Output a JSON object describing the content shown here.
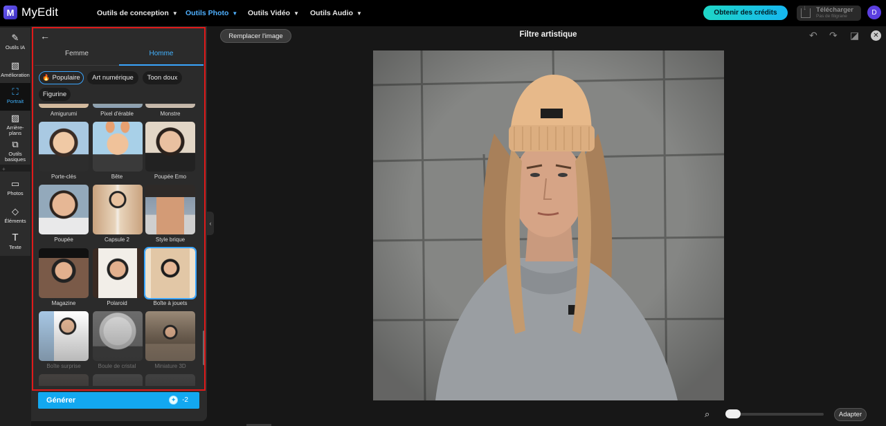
{
  "app": {
    "name": "MyEdit",
    "logo_letter": "M"
  },
  "nav": [
    {
      "label": "Outils de conception",
      "active": false
    },
    {
      "label": "Outils Photo",
      "active": true
    },
    {
      "label": "Outils Vidéo",
      "active": false
    },
    {
      "label": "Outils Audio",
      "active": false
    }
  ],
  "header": {
    "credits_button": "Obtenir des crédits",
    "download_title": "Télécharger",
    "download_sub": "Pas de filigrane",
    "avatar_initial": "D"
  },
  "rail": [
    {
      "label": "Outils IA",
      "icon": "magic-wand-icon",
      "glyph": "✎",
      "active": false
    },
    {
      "label": "Amélioration",
      "icon": "enhance-icon",
      "glyph": "▧",
      "active": false
    },
    {
      "label": "Portrait",
      "icon": "portrait-icon",
      "glyph": "⛶",
      "active": true
    },
    {
      "label": "Arrière-plans",
      "icon": "background-icon",
      "glyph": "▨",
      "active": false
    },
    {
      "label": "Outils basiques",
      "icon": "crop-icon",
      "glyph": "⧉",
      "active": false
    },
    {
      "label": "Photos",
      "icon": "photos-icon",
      "glyph": "▭",
      "active": false
    },
    {
      "label": "Éléments",
      "icon": "elements-icon",
      "glyph": "◇",
      "active": false
    },
    {
      "label": "Texte",
      "icon": "text-icon",
      "glyph": "T",
      "active": false
    }
  ],
  "panel": {
    "tabs": [
      {
        "label": "Femme",
        "active": false
      },
      {
        "label": "Homme",
        "active": true
      }
    ],
    "chips": [
      {
        "label": "Populaire",
        "active": true
      },
      {
        "label": "Art numérique",
        "active": false
      },
      {
        "label": "Toon doux",
        "active": false
      },
      {
        "label": "Figurine",
        "active": false
      }
    ],
    "top_row_labels": [
      "Amigurumi",
      "Pixel d'érable",
      "Monstre"
    ],
    "styles": [
      {
        "label": "Porte-clés",
        "selected": false
      },
      {
        "label": "Bête",
        "selected": false
      },
      {
        "label": "Poupée Emo",
        "selected": false
      },
      {
        "label": "Poupée",
        "selected": false
      },
      {
        "label": "Capsule 2",
        "selected": false
      },
      {
        "label": "Style brique",
        "selected": false
      },
      {
        "label": "Magazine",
        "selected": false
      },
      {
        "label": "Polaroid",
        "selected": false
      },
      {
        "label": "Boîte à jouets",
        "selected": true
      },
      {
        "label": "Boîte surprise",
        "selected": false
      },
      {
        "label": "Boule de cristal",
        "selected": false
      },
      {
        "label": "Miniature 3D",
        "selected": false
      }
    ],
    "generate_label": "Générer",
    "generate_cost": "-2"
  },
  "canvas": {
    "replace_label": "Remplacer l'image",
    "title": "Filtre artistique",
    "fit_label": "Adapter",
    "zoom_fraction": 0.1
  },
  "colors": {
    "accent": "#3aa6ff",
    "highlight_frame": "#e01a1a",
    "generate": "#13a8f0"
  }
}
